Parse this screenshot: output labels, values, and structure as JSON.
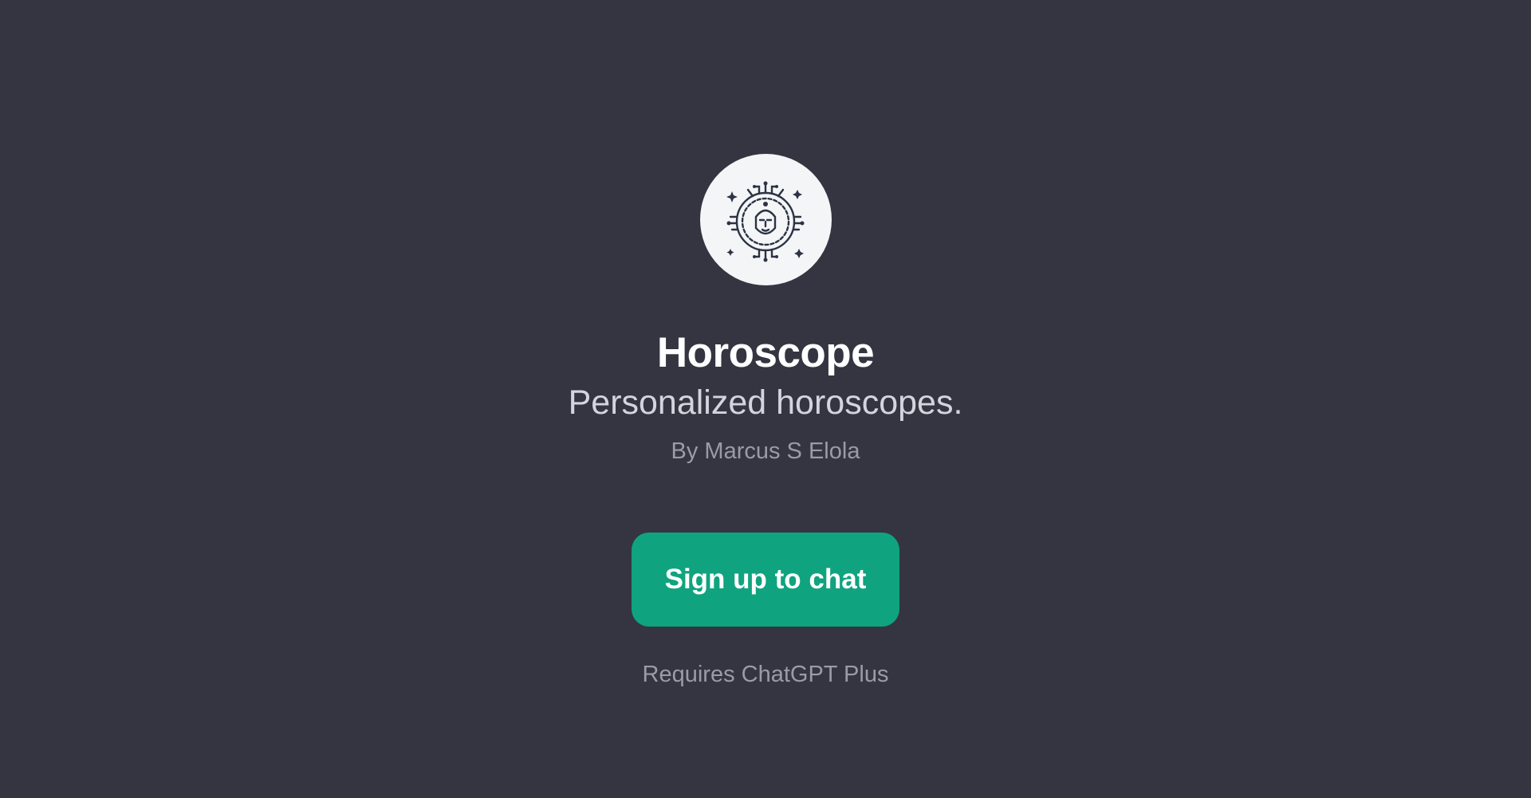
{
  "gpt": {
    "name": "Horoscope",
    "description": "Personalized horoscopes.",
    "author": "By Marcus S Elola",
    "avatar_icon": "horoscope-emblem-icon"
  },
  "actions": {
    "signup_label": "Sign up to chat"
  },
  "footer": {
    "requirement": "Requires ChatGPT Plus"
  },
  "colors": {
    "background": "#343541",
    "accent": "#10a37f",
    "avatar_bg": "#f4f5f7"
  }
}
